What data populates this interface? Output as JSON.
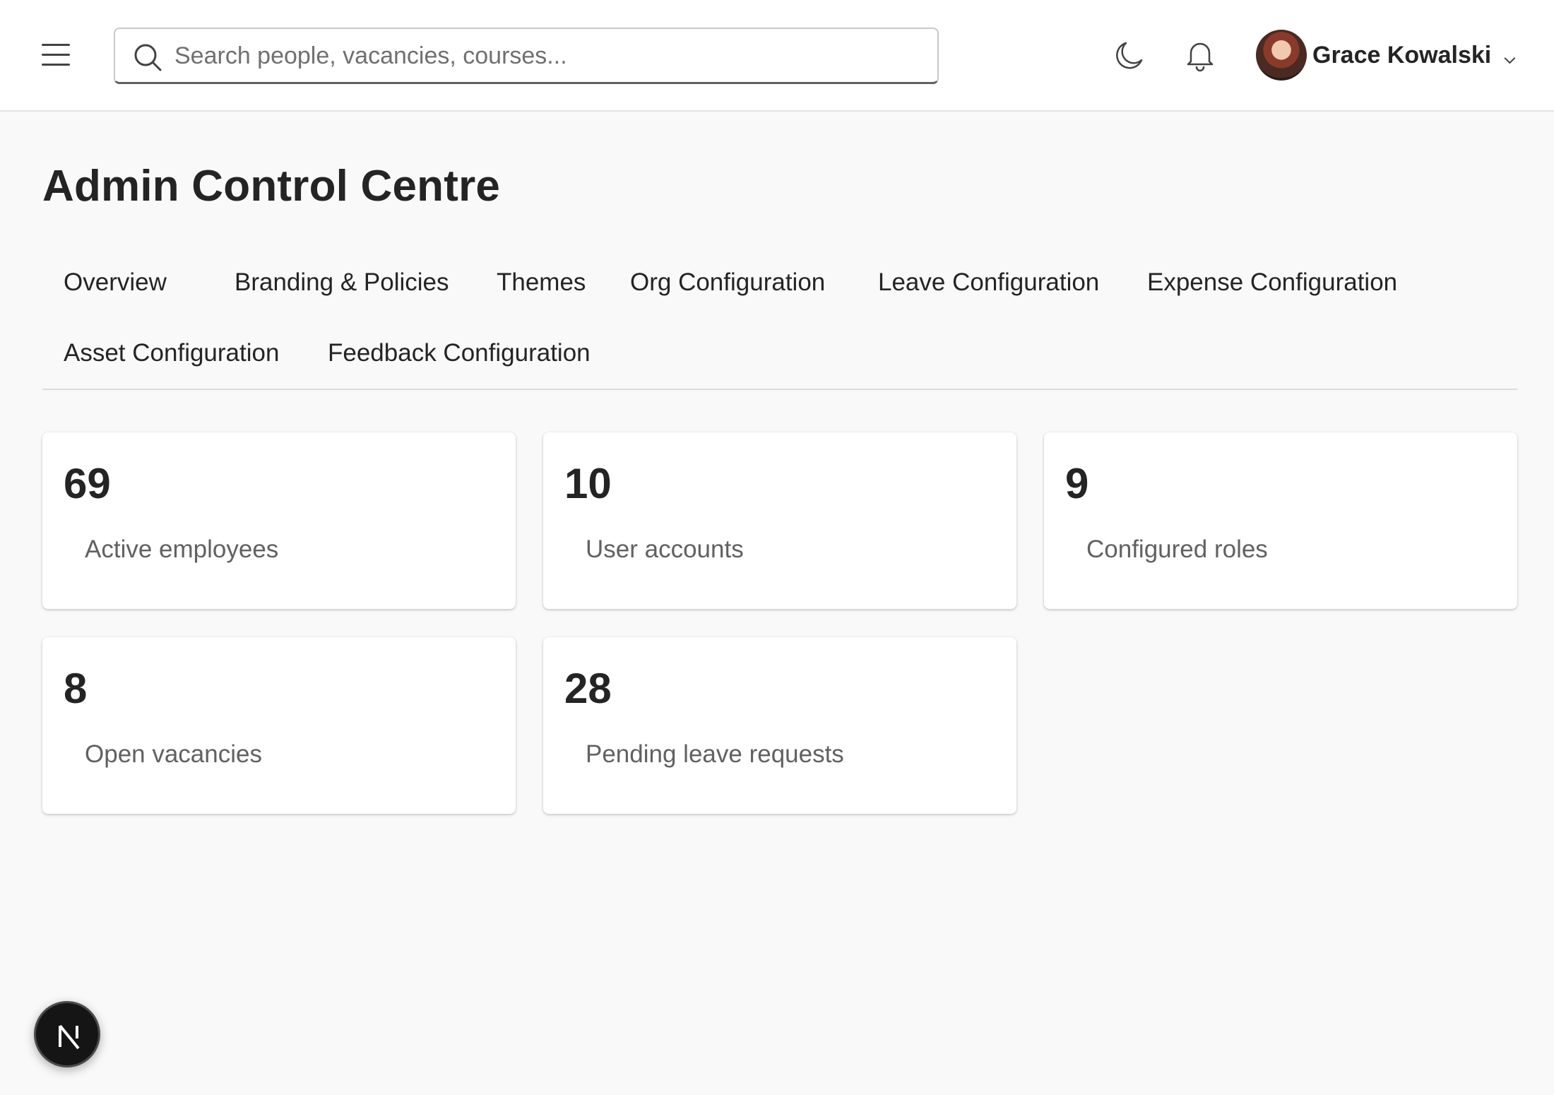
{
  "header": {
    "search_placeholder": "Search people, vacancies, courses...",
    "user_name": "Grace Kowalski",
    "icons": {
      "menu": "hamburger-menu-icon",
      "search": "search-icon",
      "theme": "moon-icon",
      "notifications": "bell-icon",
      "dropdown": "chevron-down-icon"
    }
  },
  "page": {
    "title": "Admin Control Centre"
  },
  "tabs": [
    {
      "label": "Overview"
    },
    {
      "label": "Branding & Policies"
    },
    {
      "label": "Themes"
    },
    {
      "label": "Org Configuration"
    },
    {
      "label": "Leave Configuration"
    },
    {
      "label": "Expense Configuration"
    },
    {
      "label": "Asset Configuration"
    },
    {
      "label": "Feedback Configuration"
    }
  ],
  "stats": [
    {
      "value": "69",
      "label": "Active employees"
    },
    {
      "value": "10",
      "label": "User accounts"
    },
    {
      "value": "9",
      "label": "Configured roles"
    },
    {
      "value": "8",
      "label": "Open vacancies"
    },
    {
      "value": "28",
      "label": "Pending leave requests"
    }
  ],
  "fab": {
    "letter": "N",
    "icon": "next-logo-icon"
  }
}
